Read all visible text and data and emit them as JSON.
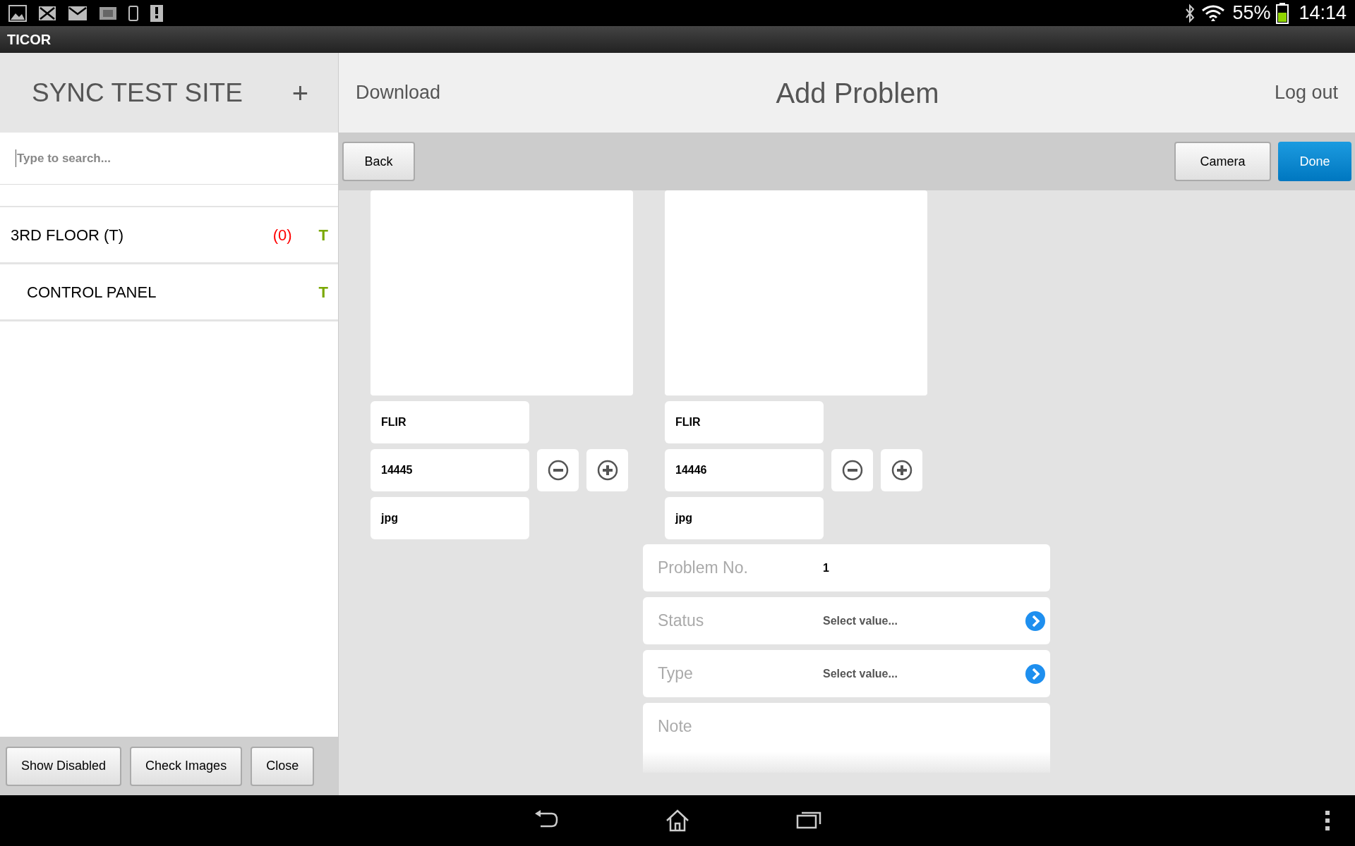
{
  "status_bar": {
    "battery": "55%",
    "time": "14:14"
  },
  "app_bar": {
    "title": "TICOR"
  },
  "sidebar": {
    "title": "SYNC TEST SITE",
    "add": "+",
    "search": {
      "placeholder": "Type to search..."
    },
    "items": [
      {
        "label": "3RD FLOOR (T)",
        "count": "(0)",
        "flag": "T",
        "children": [
          {
            "label": "CONTROL PANEL",
            "flag": "T"
          }
        ]
      }
    ],
    "buttons": [
      "Show Disabled",
      "Check Images",
      "Close"
    ]
  },
  "header": {
    "left": "Download",
    "title": "Add Problem",
    "right": "Log out"
  },
  "toolbar": {
    "back": "Back",
    "buttons": [
      {
        "label": "Camera",
        "primary": false
      },
      {
        "label": "Done",
        "primary": true
      }
    ]
  },
  "images": [
    {
      "source": "FLIR",
      "number": "14445",
      "format": "jpg"
    },
    {
      "source": "FLIR",
      "number": "14446",
      "format": "jpg"
    }
  ],
  "form": [
    {
      "kind": "text",
      "label": "Problem No.",
      "value": "1"
    },
    {
      "kind": "select",
      "label": "Status",
      "value": "Select value..."
    },
    {
      "kind": "select",
      "label": "Type",
      "value": "Select value..."
    },
    {
      "kind": "note",
      "label": "Note"
    }
  ]
}
